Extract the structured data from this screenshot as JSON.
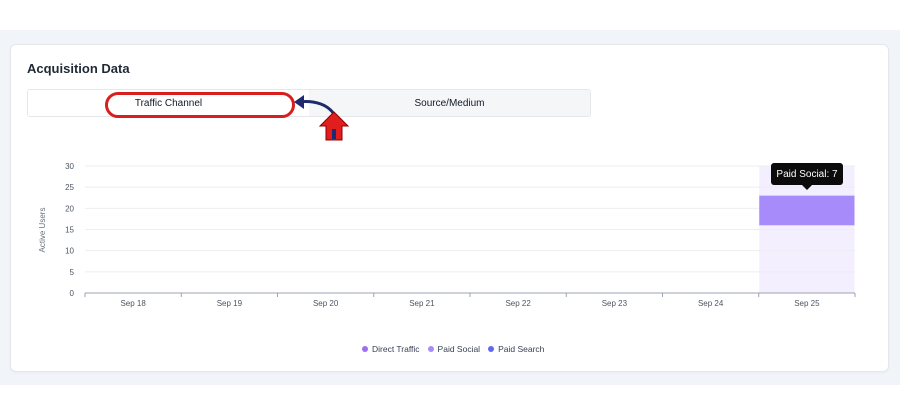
{
  "card": {
    "title": "Acquisition Data"
  },
  "tabs": [
    {
      "label": "Traffic Channel",
      "active": true
    },
    {
      "label": "Source/Medium",
      "active": false
    }
  ],
  "tooltip": {
    "text": "Paid Social: 7"
  },
  "colors": {
    "direct_traffic": "#9b6ef3",
    "paid_social": "#a78bfa",
    "paid_search": "#6366f1",
    "hover_band": "#f3efff",
    "annotation_red": "#d91e1e",
    "annotation_navy": "#1e2a6e"
  },
  "chart_data": {
    "type": "bar",
    "stacked": true,
    "ylabel": "Active Users",
    "xlabel": "",
    "ylim": [
      0,
      30
    ],
    "yticks": [
      0,
      5,
      10,
      15,
      20,
      25,
      30
    ],
    "categories": [
      "Sep 18",
      "Sep 19",
      "Sep 20",
      "Sep 21",
      "Sep 22",
      "Sep 23",
      "Sep 24",
      "Sep 25"
    ],
    "series": [
      {
        "name": "Direct Traffic",
        "values": [
          0,
          0,
          0,
          0,
          0,
          0,
          0,
          0
        ]
      },
      {
        "name": "Paid Social",
        "values": [
          0,
          0,
          0,
          0,
          0,
          0,
          0,
          7
        ]
      },
      {
        "name": "Paid Search",
        "values": [
          0,
          0,
          0,
          0,
          0,
          0,
          0,
          0
        ]
      }
    ],
    "hover_category": "Sep 25",
    "hover_total": 23,
    "grid": true,
    "legend_position": "bottom-center"
  }
}
